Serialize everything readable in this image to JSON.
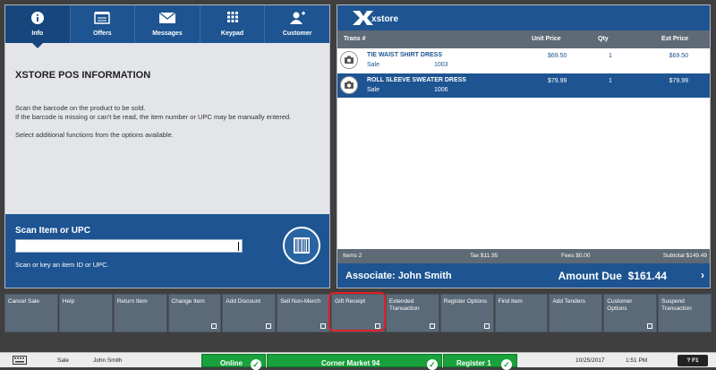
{
  "nav": {
    "tabs": [
      {
        "label": "Info",
        "icon": "info-icon"
      },
      {
        "label": "Offers",
        "icon": "offers-icon"
      },
      {
        "label": "Messages",
        "icon": "envelope-icon"
      },
      {
        "label": "Keypad",
        "icon": "keypad-icon"
      },
      {
        "label": "Customer",
        "icon": "add-customer-icon"
      }
    ],
    "active": "Info"
  },
  "info": {
    "title": "XSTORE POS INFORMATION",
    "line1": "Scan the barcode on the product to be sold.",
    "line2": "If the barcode is missing or can't be read, the item number or UPC may be manually entered.",
    "line3": "Select additional functions from the options available."
  },
  "scan": {
    "title": "Scan Item or UPC",
    "value": "",
    "hint": "Scan or key an item ID or UPC."
  },
  "logo": {
    "text": "xstore"
  },
  "grid": {
    "headers": {
      "trans": "Trans #",
      "unit_price": "Unit Price",
      "qty": "Qty",
      "ext_price": "Ext Price"
    },
    "rows": [
      {
        "name": "TIE WAIST SHIRT DRESS",
        "type": "Sale",
        "sku": "1003",
        "unit_price": "$69.50",
        "qty": "1",
        "ext_price": "$69.50"
      },
      {
        "name": "ROLL SLEEVE SWEATER DRESS",
        "type": "Sale",
        "sku": "1006",
        "unit_price": "$79.99",
        "qty": "1",
        "ext_price": "$79.99"
      }
    ]
  },
  "totals": {
    "items": "Items 2",
    "tax": "Tax $11.95",
    "fees": "Fees $0.00",
    "subtotal": "Subtotal $149.49"
  },
  "associate": {
    "label": "Associate: John Smith",
    "amount_label": "Amount Due",
    "amount": "$161.44"
  },
  "fkeys": [
    {
      "label": "Cancel Sale"
    },
    {
      "label": "Help"
    },
    {
      "label": "Return Item"
    },
    {
      "label": "Change Item"
    },
    {
      "label": "Add Discount"
    },
    {
      "label": "Sell Non-Merch"
    },
    {
      "label": "Gift Receipt"
    },
    {
      "label": "Extended Transaction"
    },
    {
      "label": "Register Options"
    },
    {
      "label": "Find Item"
    },
    {
      "label": "Add Tenders"
    },
    {
      "label": "Customer Options"
    },
    {
      "label": "Suspend Transaction"
    }
  ],
  "status": {
    "mode": "Sale",
    "user": "John Smith",
    "online": "Online",
    "store": "Corner Market 94",
    "register": "Register 1",
    "date": "10/25/2017",
    "time": "1:51 PM",
    "help": "? F1"
  },
  "colors": {
    "brand": "#1d5491",
    "accent_green": "#19a13b",
    "highlight": "#e31e25"
  }
}
